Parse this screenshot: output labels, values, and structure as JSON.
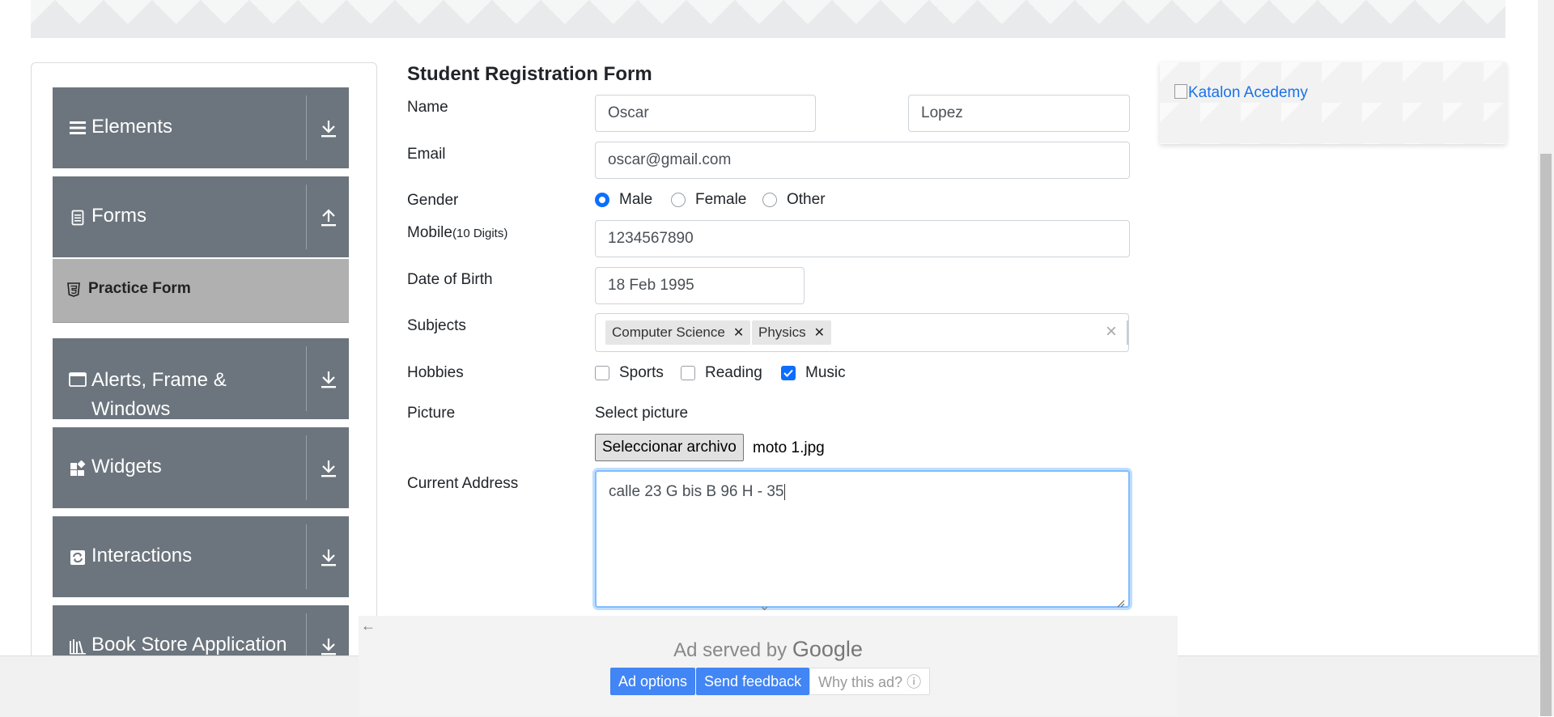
{
  "sidebar": {
    "groups": [
      {
        "label": "Elements",
        "icon": "menu-icon",
        "toggle": "download-icon"
      },
      {
        "label": "Forms",
        "icon": "document-icon",
        "toggle": "upload-icon"
      },
      {
        "label": "Alerts, Frame & Windows",
        "icon": "window-icon",
        "toggle": "download-icon"
      },
      {
        "label": "Widgets",
        "icon": "widgets-icon",
        "toggle": "download-icon"
      },
      {
        "label": "Interactions",
        "icon": "sync-icon",
        "toggle": "download-icon"
      },
      {
        "label": "Book Store Application",
        "icon": "books-icon",
        "toggle": "download-icon"
      }
    ],
    "active_item": {
      "label": "Practice Form",
      "icon": "html5-icon"
    }
  },
  "form": {
    "title": "Student Registration Form",
    "name_label": "Name",
    "first_name": "Oscar",
    "last_name": "Lopez",
    "email_label": "Email",
    "email": "oscar@gmail.com",
    "gender_label": "Gender",
    "gender_options": [
      "Male",
      "Female",
      "Other"
    ],
    "gender_selected": "Male",
    "mobile_label": "Mobile",
    "mobile_hint": "(10 Digits)",
    "mobile": "1234567890",
    "dob_label": "Date of Birth",
    "dob": "18 Feb 1995",
    "subjects_label": "Subjects",
    "subjects": [
      "Computer Science",
      "Physics"
    ],
    "hobbies_label": "Hobbies",
    "hobbies": [
      {
        "label": "Sports",
        "checked": false
      },
      {
        "label": "Reading",
        "checked": false
      },
      {
        "label": "Music",
        "checked": true
      }
    ],
    "picture_label": "Picture",
    "select_picture": "Select picture",
    "file_button": "Seleccionar archivo",
    "file_name": "moto 1.jpg",
    "address_label": "Current Address",
    "address": "calle 23 G bis B 96 H - 35"
  },
  "side_ad": {
    "alt_text": "Katalon Acedemy"
  },
  "bottom_ad": {
    "served_by": "Ad served by",
    "brand": "Google",
    "buttons": [
      "Ad options",
      "Send feedback",
      "Why this ad?"
    ]
  },
  "colors": {
    "sidebar_bg": "#6c757d",
    "active_item_bg": "#b0b0b0",
    "accent": "#0d6efd",
    "ad_button": "#4285f4"
  }
}
